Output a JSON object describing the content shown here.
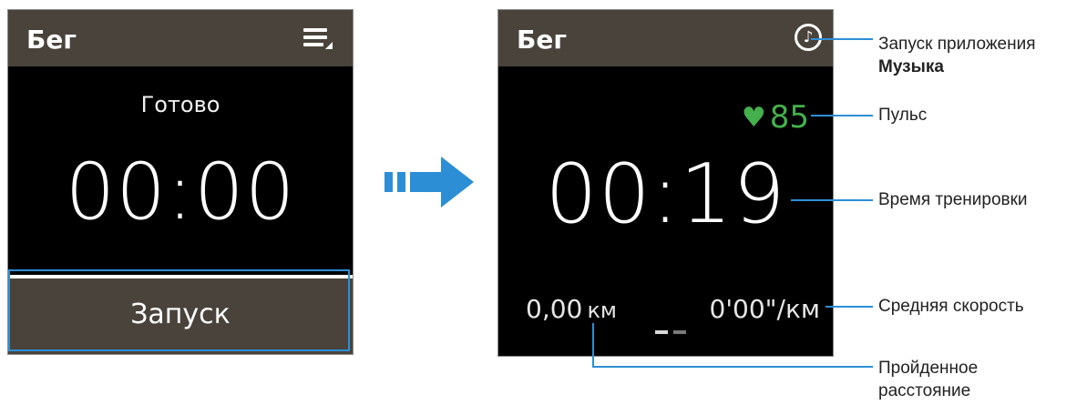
{
  "left_screen": {
    "title": "Бег",
    "menu_icon": "menu-icon",
    "status": "Готово",
    "timer": "00:00",
    "start_button": "Запуск"
  },
  "right_screen": {
    "title": "Бег",
    "music_icon": "music-note-icon",
    "heart_icon": "heart-icon",
    "pulse": "85",
    "timer": "00:19",
    "distance_value": "0,00",
    "distance_unit": "км",
    "speed_value": "0'00\"/км"
  },
  "callouts": {
    "music_line1": "Запуск приложения",
    "music_line2": "Музыка",
    "pulse": "Пульс",
    "time": "Время тренировки",
    "speed": "Средняя скорость",
    "distance_line1": "Пройденное",
    "distance_line2": "расстояние"
  },
  "colors": {
    "header": "#4a433b",
    "accent_blue": "#2c8fd6",
    "pulse_green": "#44b04c"
  }
}
